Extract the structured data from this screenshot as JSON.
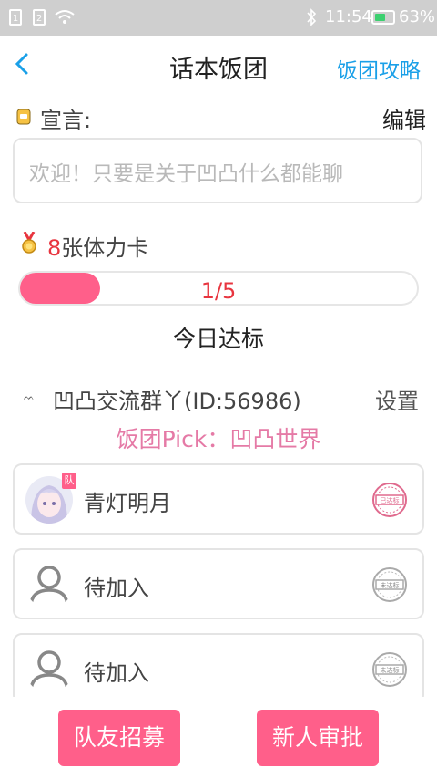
{
  "status_bar": {
    "notification_1": "1",
    "notification_2": "2",
    "time": "11:54",
    "battery": "63%",
    "battery_level": 0.63
  },
  "header": {
    "title": "话本饭团",
    "strategy_link": "饭团攻略",
    "back_icon": "chevron-left-icon"
  },
  "declaration": {
    "label": "宣言:",
    "edit_label": "编辑",
    "text": "欢迎！只要是关于凹凸什么都能聊"
  },
  "stamina": {
    "count": "8",
    "suffix": "张体力卡"
  },
  "progress": {
    "text": "1/5",
    "value": 0.2
  },
  "today_label": "今日达标",
  "group": {
    "name": "凹凸交流群丫(ID:56986)",
    "settings_label": "设置"
  },
  "pick": "饭团Pick：凹凸世界",
  "members": [
    {
      "name": "青灯明月",
      "badge": "队",
      "stamp": "已达标",
      "is_captain": true
    },
    {
      "name": "待加入",
      "stamp": "未达标"
    },
    {
      "name": "待加入",
      "stamp": "未达标"
    }
  ],
  "buttons": {
    "recruit": "队友招募",
    "approve": "新人审批"
  },
  "colors": {
    "accent_pink": "#ff5f8a",
    "link_blue": "#1aa0e8",
    "red_text": "#e8353f",
    "pick_pink": "#e57aa6"
  }
}
